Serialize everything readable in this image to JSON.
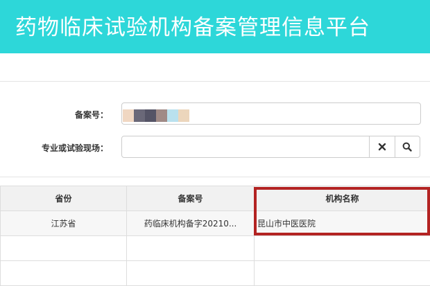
{
  "header": {
    "title": "药物临床试验机构备案管理信息平台"
  },
  "form": {
    "record_no_label": "备案号：",
    "record_no_value": "",
    "specialty_label": "专业或试验现场：",
    "specialty_value": ""
  },
  "masked_colors": [
    "#f0d7c2",
    "#6a6878",
    "#555466",
    "#a08a86",
    "#b9e1ee",
    "#ecd6bc"
  ],
  "colors": {
    "header_bg": "#2dd7d9",
    "highlight": "#b32322"
  },
  "table": {
    "columns": [
      "省份",
      "备案号",
      "机构名称"
    ],
    "rows": [
      [
        "江苏省",
        "药临床机构备字20210...",
        "昆山市中医医院"
      ],
      [
        "",
        "",
        ""
      ],
      [
        "",
        "",
        ""
      ]
    ]
  },
  "icons": {
    "clear": "close-icon",
    "search": "search-icon"
  }
}
